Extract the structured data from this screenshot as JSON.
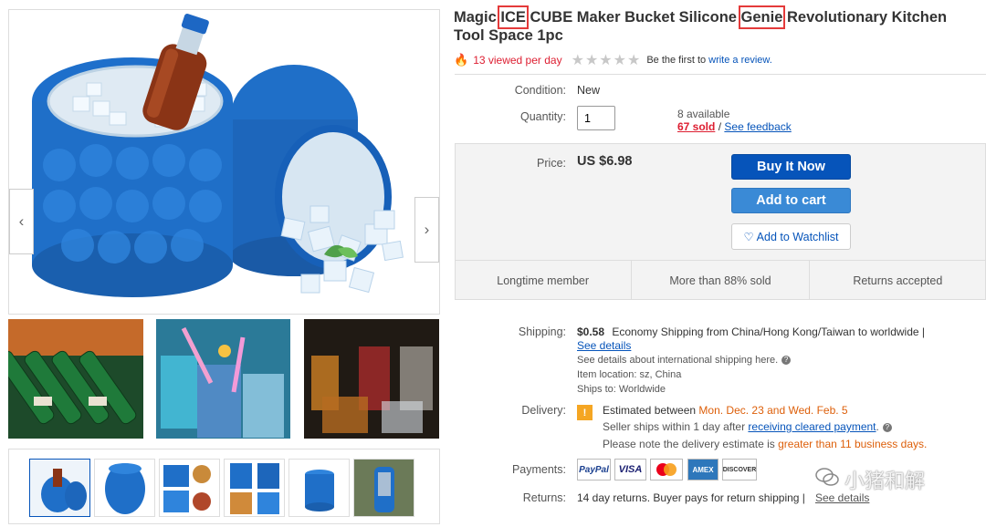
{
  "gallery": {
    "prev_label": "‹",
    "next_label": "›"
  },
  "product": {
    "title_1": "Magic ",
    "title_ice": "ICE",
    "title_2": " CUBE Maker Bucket Silicone ",
    "title_genie": "Genie",
    "title_3": " Revolutionary Kitchen Tool Space 1pc",
    "views": "13 viewed per day",
    "review_pre": "Be the first to",
    "review_link": "write a review."
  },
  "details": {
    "condition_label": "Condition:",
    "condition_value": "New",
    "quantity_label": "Quantity:",
    "quantity_value": "1",
    "available": "8 available",
    "sold": "67 sold",
    "sep": "/",
    "feedback": "See feedback"
  },
  "buybox": {
    "price_label": "Price:",
    "price_value": "US $6.98",
    "buy_now": "Buy It Now",
    "add_to_cart": "Add to cart",
    "watchlist": "Add to Watchlist",
    "badges": [
      "Longtime member",
      "More than 88% sold",
      "Returns accepted"
    ]
  },
  "shipping": {
    "label": "Shipping:",
    "cost": "$0.58",
    "desc": "Economy Shipping from China/Hong Kong/Taiwan to worldwide |",
    "details_link": "See details",
    "intl": "See details about international shipping here.",
    "location": "Item location:  sz, China",
    "ships_to": "Ships to:  Worldwide"
  },
  "delivery": {
    "label": "Delivery:",
    "est_pre": "Estimated between ",
    "est_dates": "Mon. Dec. 23 and Wed. Feb. 5",
    "seller_pre": "Seller ships within 1 day after ",
    "seller_link": "receiving cleared payment",
    "seller_post": ".",
    "note_pre": "Please note the delivery estimate is ",
    "note_red": "greater than 11 business days."
  },
  "payments": {
    "label": "Payments:",
    "methods": [
      "PayPal",
      "VISA",
      "MC",
      "AMEX",
      "DISCOVER"
    ]
  },
  "returns": {
    "label": "Returns:",
    "text": "14 day returns. Buyer pays for return shipping |",
    "link": "See details"
  },
  "watermark": "小猪和解",
  "colors": {
    "link": "#0654ba",
    "buy_button": "#0654ba",
    "cart_button": "#3a8ad6",
    "alert_red": "#dd1e31",
    "highlight_box": "#e43a3a",
    "product_blue": "#1f6fc8"
  }
}
